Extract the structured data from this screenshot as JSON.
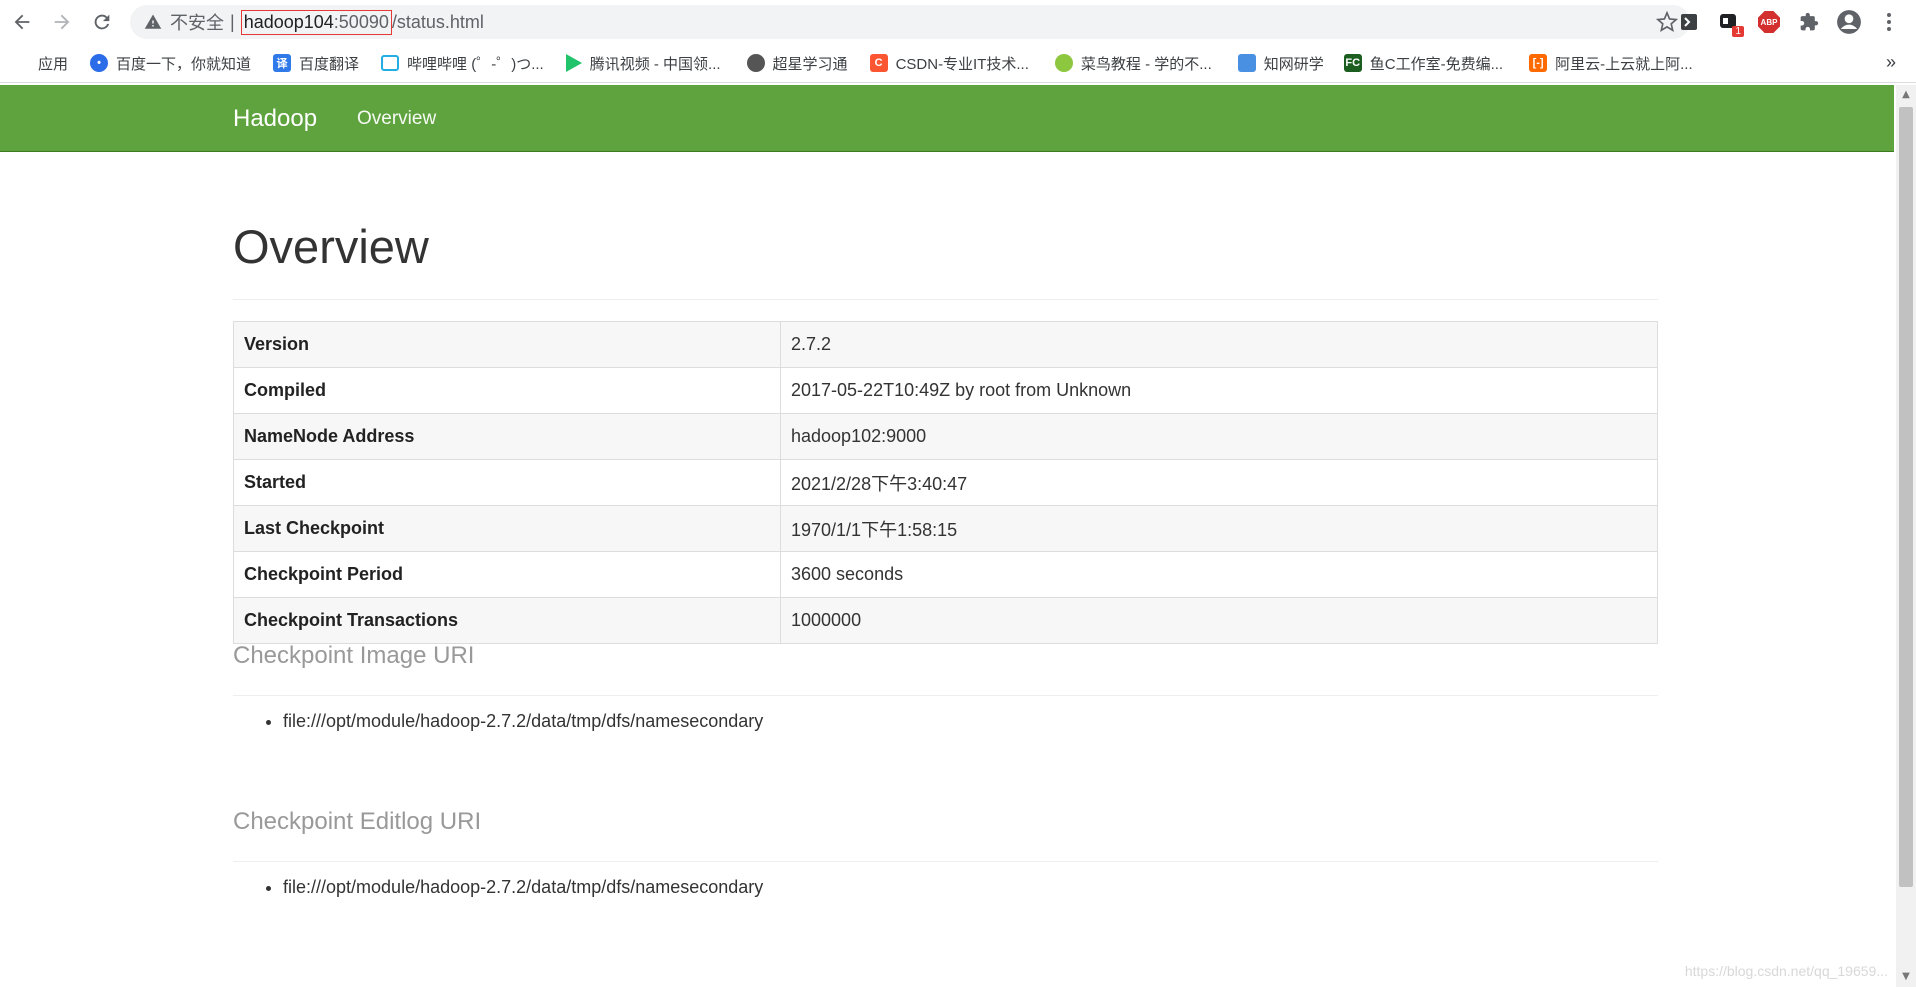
{
  "browser": {
    "security_label": "不安全",
    "separator": "|",
    "url_host": "hadoop104",
    "url_port": ":50090",
    "url_path": "/status.html",
    "bookmarks": [
      {
        "label": "应用",
        "color": "#ea4335"
      },
      {
        "label": "百度一下，你就知道",
        "color": "#2b6de8"
      },
      {
        "label": "百度翻译",
        "color": "#2f79e8"
      },
      {
        "label": "哔哩哔哩 (゜-゜)つ...",
        "color": "#23ade5"
      },
      {
        "label": "腾讯视频 - 中国领...",
        "color": "#21c36b"
      },
      {
        "label": "超星学习通",
        "color": "#555555"
      },
      {
        "label": "CSDN-专业IT技术...",
        "color": "#fc5531"
      },
      {
        "label": "菜鸟教程 - 学的不...",
        "color": "#8dc63f"
      },
      {
        "label": "知网研学",
        "color": "#4a90e2"
      },
      {
        "label": "鱼C工作室-免费编...",
        "color": "#1b5e20"
      },
      {
        "label": "阿里云-上云就上阿...",
        "color": "#ff6a00"
      }
    ],
    "more": "»",
    "ext_badge": "1",
    "abp_label": "ABP"
  },
  "navbar": {
    "brand": "Hadoop",
    "overview_link": "Overview",
    "bg_color": "#5fa33e"
  },
  "page": {
    "title": "Overview",
    "info_rows": [
      {
        "key": "Version",
        "value": "2.7.2"
      },
      {
        "key": "Compiled",
        "value": "2017-05-22T10:49Z by root from Unknown"
      },
      {
        "key": "NameNode Address",
        "value": "hadoop102:9000"
      },
      {
        "key": "Started",
        "value": "2021/2/28下午3:40:47"
      },
      {
        "key": "Last Checkpoint",
        "value": "1970/1/1下午1:58:15"
      },
      {
        "key": "Checkpoint Period",
        "value": "3600 seconds"
      },
      {
        "key": "Checkpoint Transactions",
        "value": "1000000"
      }
    ],
    "image_uri_heading": "Checkpoint Image URI",
    "image_uris": [
      "file:///opt/module/hadoop-2.7.2/data/tmp/dfs/namesecondary"
    ],
    "editlog_uri_heading": "Checkpoint Editlog URI",
    "editlog_uris": [
      "file:///opt/module/hadoop-2.7.2/data/tmp/dfs/namesecondary"
    ]
  },
  "watermark": "https://blog.csdn.net/qq_19659..."
}
